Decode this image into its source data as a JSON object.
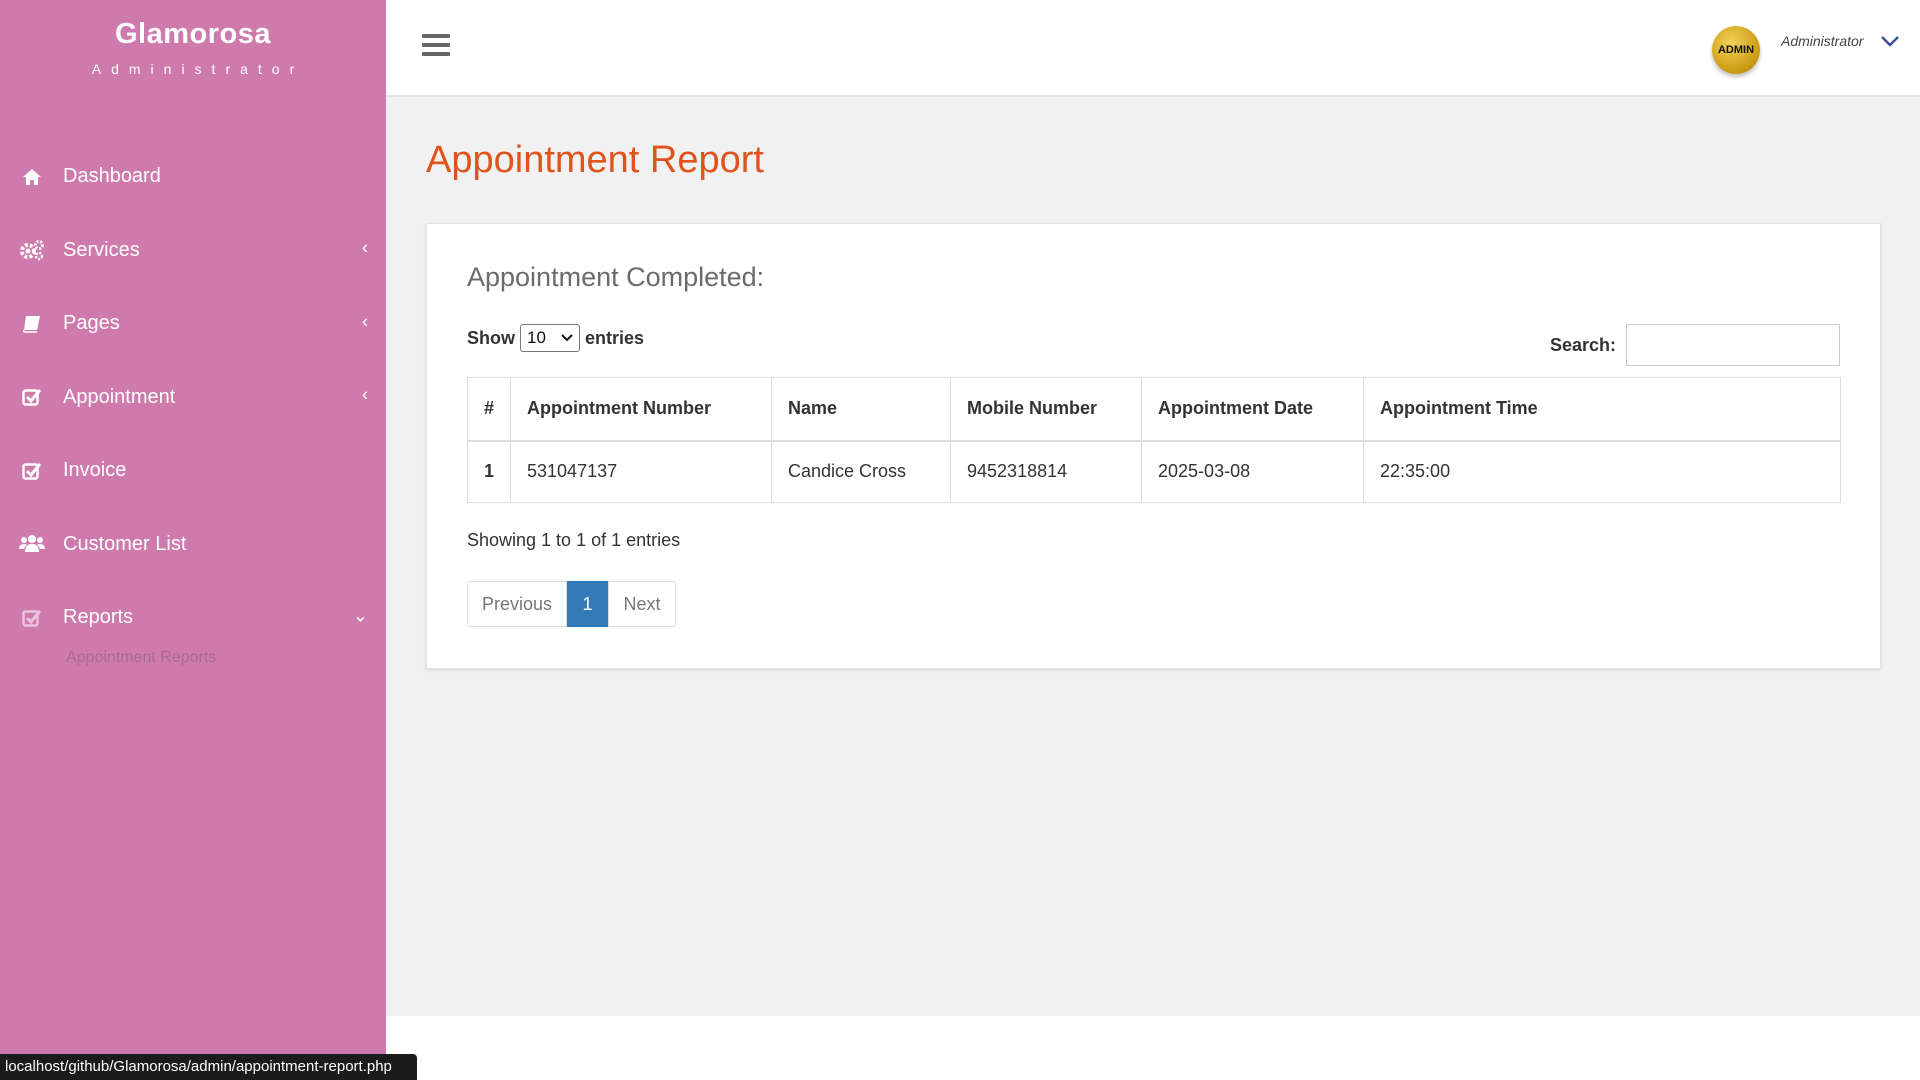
{
  "brand": {
    "name": "Glamorosa",
    "subtitle": "Administrator"
  },
  "sidebar": {
    "items": [
      {
        "label": "Dashboard",
        "icon": "home-icon"
      },
      {
        "label": "Services",
        "icon": "gears-icon",
        "caret": "‹"
      },
      {
        "label": "Pages",
        "icon": "book-icon",
        "caret": "‹"
      },
      {
        "label": "Appointment",
        "icon": "check-square-icon",
        "caret": "‹"
      },
      {
        "label": "Invoice",
        "icon": "check-square-icon"
      },
      {
        "label": "Customer List",
        "icon": "users-icon"
      },
      {
        "label": "Reports",
        "icon": "check-square-icon",
        "caret": "⌄"
      }
    ],
    "submenu": {
      "label": "Appointment Reports"
    }
  },
  "header": {
    "avatar_text": "ADMIN",
    "user_name": "Administrator"
  },
  "page": {
    "title": "Appointment Report",
    "card_heading": "Appointment Completed:",
    "length": {
      "prefix": "Show",
      "value": "10",
      "suffix": "entries"
    },
    "search_label": "Search:",
    "search_value": "",
    "table": {
      "headers": [
        "#",
        "Appointment Number",
        "Name",
        "Mobile Number",
        "Appointment Date",
        "Appointment Time"
      ],
      "rows": [
        [
          "1",
          "531047137",
          "Candice Cross",
          "9452318814",
          "2025-03-08",
          "22:35:00"
        ]
      ]
    },
    "info": "Showing 1 to 1 of 1 entries",
    "pagination": {
      "previous": "Previous",
      "current": "1",
      "next": "Next"
    }
  },
  "statusbar": {
    "url": "localhost/github/Glamorosa/admin/appointment-report.php"
  },
  "colors": {
    "sidebar": "#cf7aad",
    "title": "#e0531b",
    "active_page": "#337ab7",
    "main_bg": "#f1f1f1"
  }
}
